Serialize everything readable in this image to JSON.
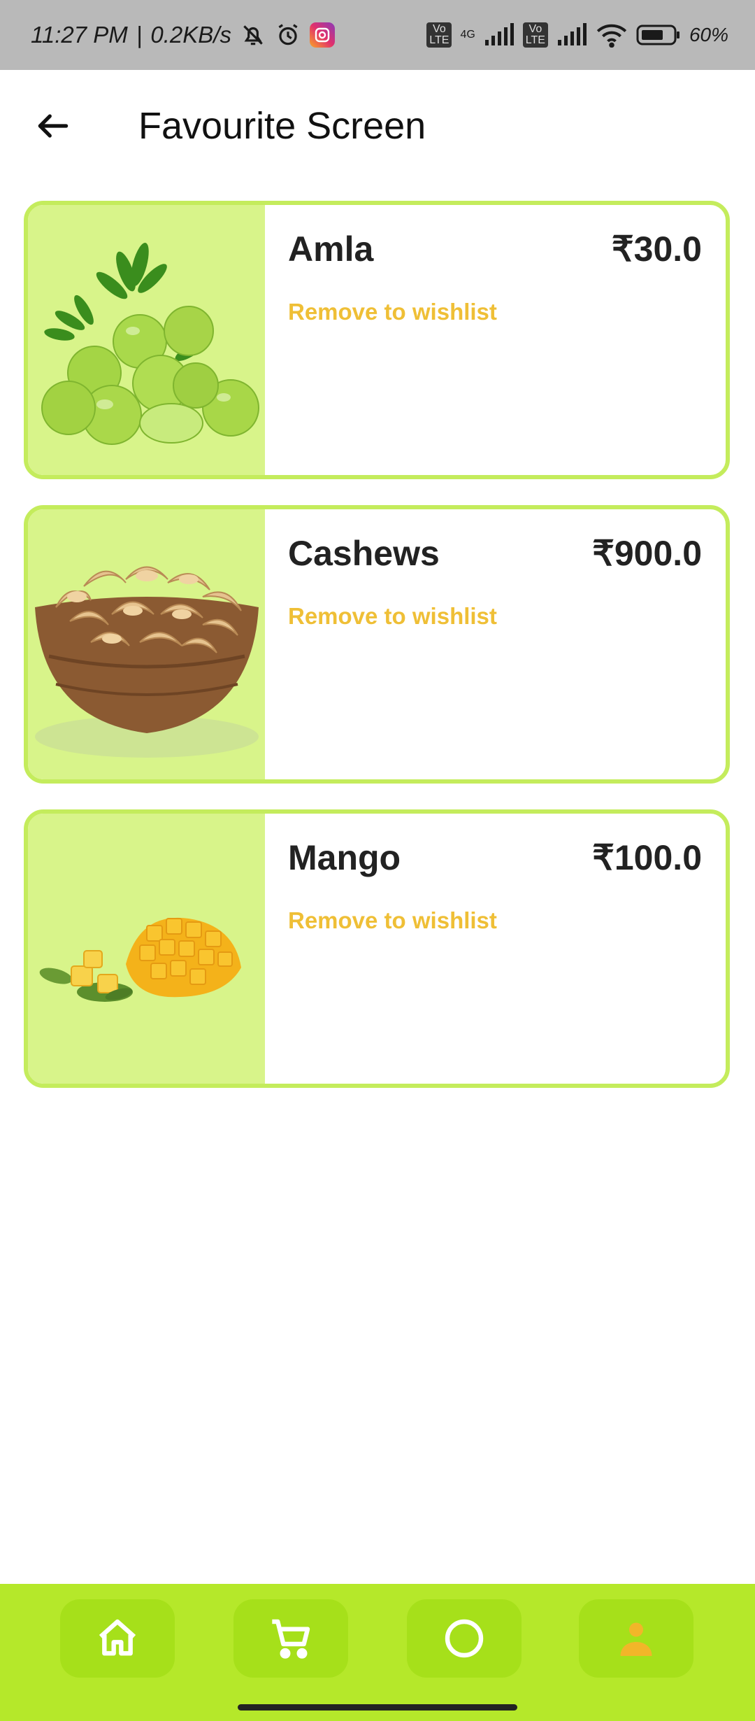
{
  "status_bar": {
    "time": "11:27 PM",
    "net_speed": "0.2KB/s",
    "network_tag": "4G",
    "battery": "60%"
  },
  "appbar": {
    "title": "Favourite Screen"
  },
  "favourites": [
    {
      "name": "Amla",
      "price": "₹30.0",
      "action": "Remove to wishlist",
      "image": "amla-image"
    },
    {
      "name": "Cashews",
      "price": "₹900.0",
      "action": "Remove to wishlist",
      "image": "cashews-image"
    },
    {
      "name": "Mango",
      "price": "₹100.0",
      "action": "Remove to wishlist",
      "image": "mango-image"
    }
  ],
  "bottom_nav": {
    "items": [
      "home-icon",
      "cart-icon",
      "circle-icon",
      "person-icon"
    ],
    "active": "person-icon"
  },
  "colors": {
    "accent": "#c4ec5c",
    "thumb_bg": "#d8f48a",
    "nav_bg": "#b5e82a",
    "remove_text": "#efbf36"
  }
}
